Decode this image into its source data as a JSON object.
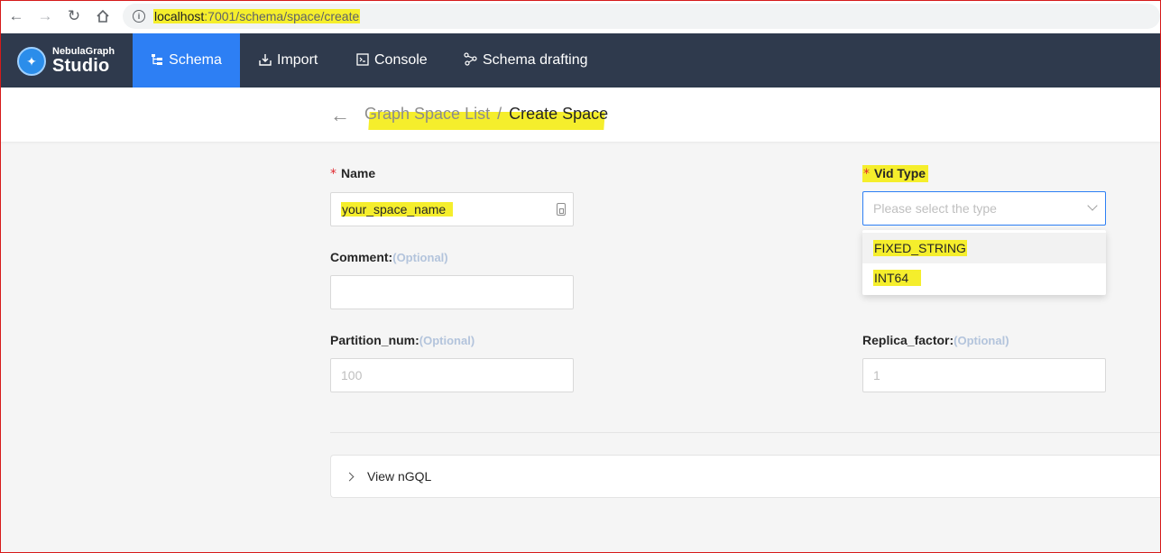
{
  "browser": {
    "url_host": "localhost",
    "url_path": ":7001/schema/space/create"
  },
  "app": {
    "logo_small": "NebulaGraph",
    "logo_big": "Studio",
    "nav": [
      {
        "label": "Schema",
        "icon": "schema-icon",
        "active": true
      },
      {
        "label": "Import",
        "icon": "import-icon",
        "active": false
      },
      {
        "label": "Console",
        "icon": "console-icon",
        "active": false
      },
      {
        "label": "Schema drafting",
        "icon": "drafting-icon",
        "active": false
      }
    ]
  },
  "breadcrumb": {
    "parent": "Graph Space List",
    "separator": "/",
    "current": "Create Space"
  },
  "form": {
    "name": {
      "required_mark": "*",
      "label": "Name",
      "value": "your_space_name"
    },
    "vid_type": {
      "required_mark": "*",
      "label": "Vid Type",
      "placeholder": "Please select the type",
      "options": [
        "FIXED_STRING",
        "INT64"
      ]
    },
    "comment": {
      "label": "Comment:",
      "optional": "(Optional)",
      "value": ""
    },
    "partition_num": {
      "label": "Partition_num:",
      "optional": "(Optional)",
      "placeholder": "100"
    },
    "replica_factor": {
      "label": "Replica_factor:",
      "optional": "(Optional)",
      "placeholder": "1"
    }
  },
  "ngql_panel": {
    "label": "View nGQL"
  },
  "colors": {
    "nav_bg": "#2f3a4d",
    "active_tab": "#2d7ff4",
    "highlight": "#f5ee2c",
    "required": "#e0282e"
  }
}
